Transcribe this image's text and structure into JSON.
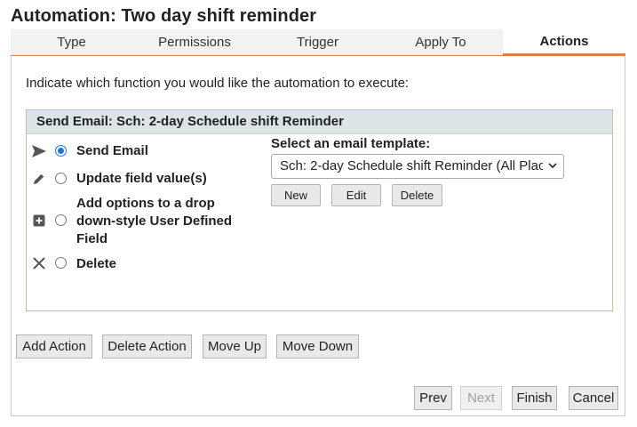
{
  "title": "Automation: Two day shift reminder",
  "tabs": [
    {
      "label": "Type",
      "active": false
    },
    {
      "label": "Permissions",
      "active": false
    },
    {
      "label": "Trigger",
      "active": false
    },
    {
      "label": "Apply To",
      "active": false
    },
    {
      "label": "Actions",
      "active": true
    }
  ],
  "instruction": "Indicate which function you would like the automation to execute:",
  "action": {
    "header": "Send Email: Sch: 2-day Schedule shift Reminder",
    "options": [
      {
        "label": "Send Email",
        "icon": "send-icon",
        "checked": true
      },
      {
        "label": "Update field value(s)",
        "icon": "pencil-icon",
        "checked": false
      },
      {
        "label_lines": [
          "Add options to a drop",
          "down-style User Defined",
          "Field"
        ],
        "icon": "plus-square-icon",
        "checked": false
      },
      {
        "label": "Delete",
        "icon": "x-icon",
        "checked": false
      }
    ],
    "template_label": "Select an email template:",
    "template_value": "Sch: 2-day Schedule shift Reminder (All Place",
    "template_buttons": {
      "new": "New",
      "edit": "Edit",
      "delete": "Delete"
    }
  },
  "action_buttons": {
    "add": "Add Action",
    "delete": "Delete Action",
    "move_up": "Move Up",
    "move_down": "Move Down"
  },
  "nav_buttons": {
    "prev": "Prev",
    "next": "Next",
    "finish": "Finish",
    "cancel": "Cancel"
  },
  "colors": {
    "active_tab_underline": "#e07b52",
    "radio_selected": "#1a73e8",
    "action_header_bg": "#dde4e8"
  }
}
